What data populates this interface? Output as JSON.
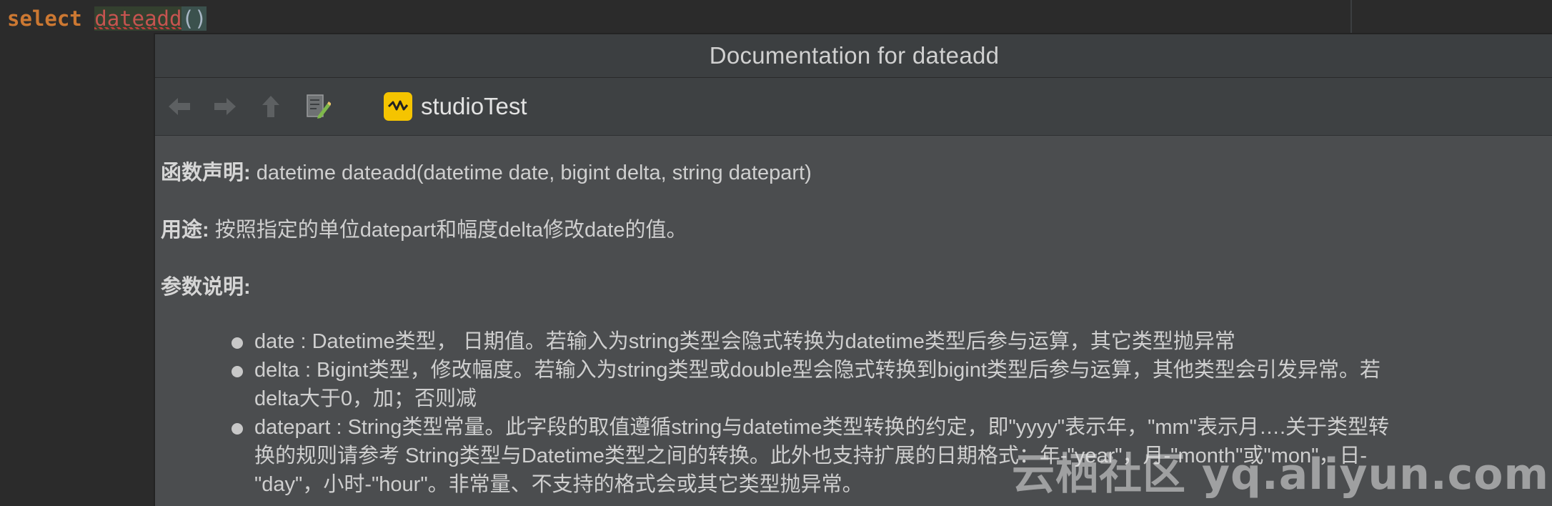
{
  "editor": {
    "keyword": "select",
    "function_name": "dateadd",
    "parens": "()",
    "squiggle": "~"
  },
  "doc_popup": {
    "title": "Documentation for dateadd",
    "toolbar": {
      "back_icon": "arrow-left-icon",
      "forward_icon": "arrow-right-icon",
      "up_icon": "arrow-up-icon",
      "edit_icon": "edit-source-icon",
      "module_icon": "studio-module-icon",
      "module_name": "studioTest"
    },
    "declaration": {
      "label": "函数声明:",
      "text": " datetime dateadd(datetime date, bigint delta, string datepart)"
    },
    "purpose": {
      "label": "用途:",
      "text": " 按照指定的单位datepart和幅度delta修改date的值。"
    },
    "params": {
      "label": "参数说明:",
      "items": [
        "date : Datetime类型， 日期值。若输入为string类型会隐式转换为datetime类型后参与运算，其它类型抛异常",
        "delta : Bigint类型，修改幅度。若输入为string类型或double型会隐式转换到bigint类型后参与运算，其他类型会引发异常。若\ndelta大于0，加；否则减",
        "datepart : String类型常量。此字段的取值遵循string与datetime类型转换的约定，即\"yyyy\"表示年，\"mm\"表示月….关于类型转\n换的规则请参考 String类型与Datetime类型之间的转换。此外也支持扩展的日期格式：年-\"year\"，月-\"month\"或\"mon\"，日-\n\"day\"，小时-\"hour\"。非常量、不支持的格式会或其它类型抛异常。"
      ]
    }
  },
  "watermark": "云栖社区 yq.aliyun.com",
  "colors": {
    "editor_bg": "#2b2b2b",
    "keyword": "#cc7832",
    "error_fn": "#c75450",
    "popup_bg": "#4b4d4f",
    "module_icon_bg": "#f5c400"
  }
}
